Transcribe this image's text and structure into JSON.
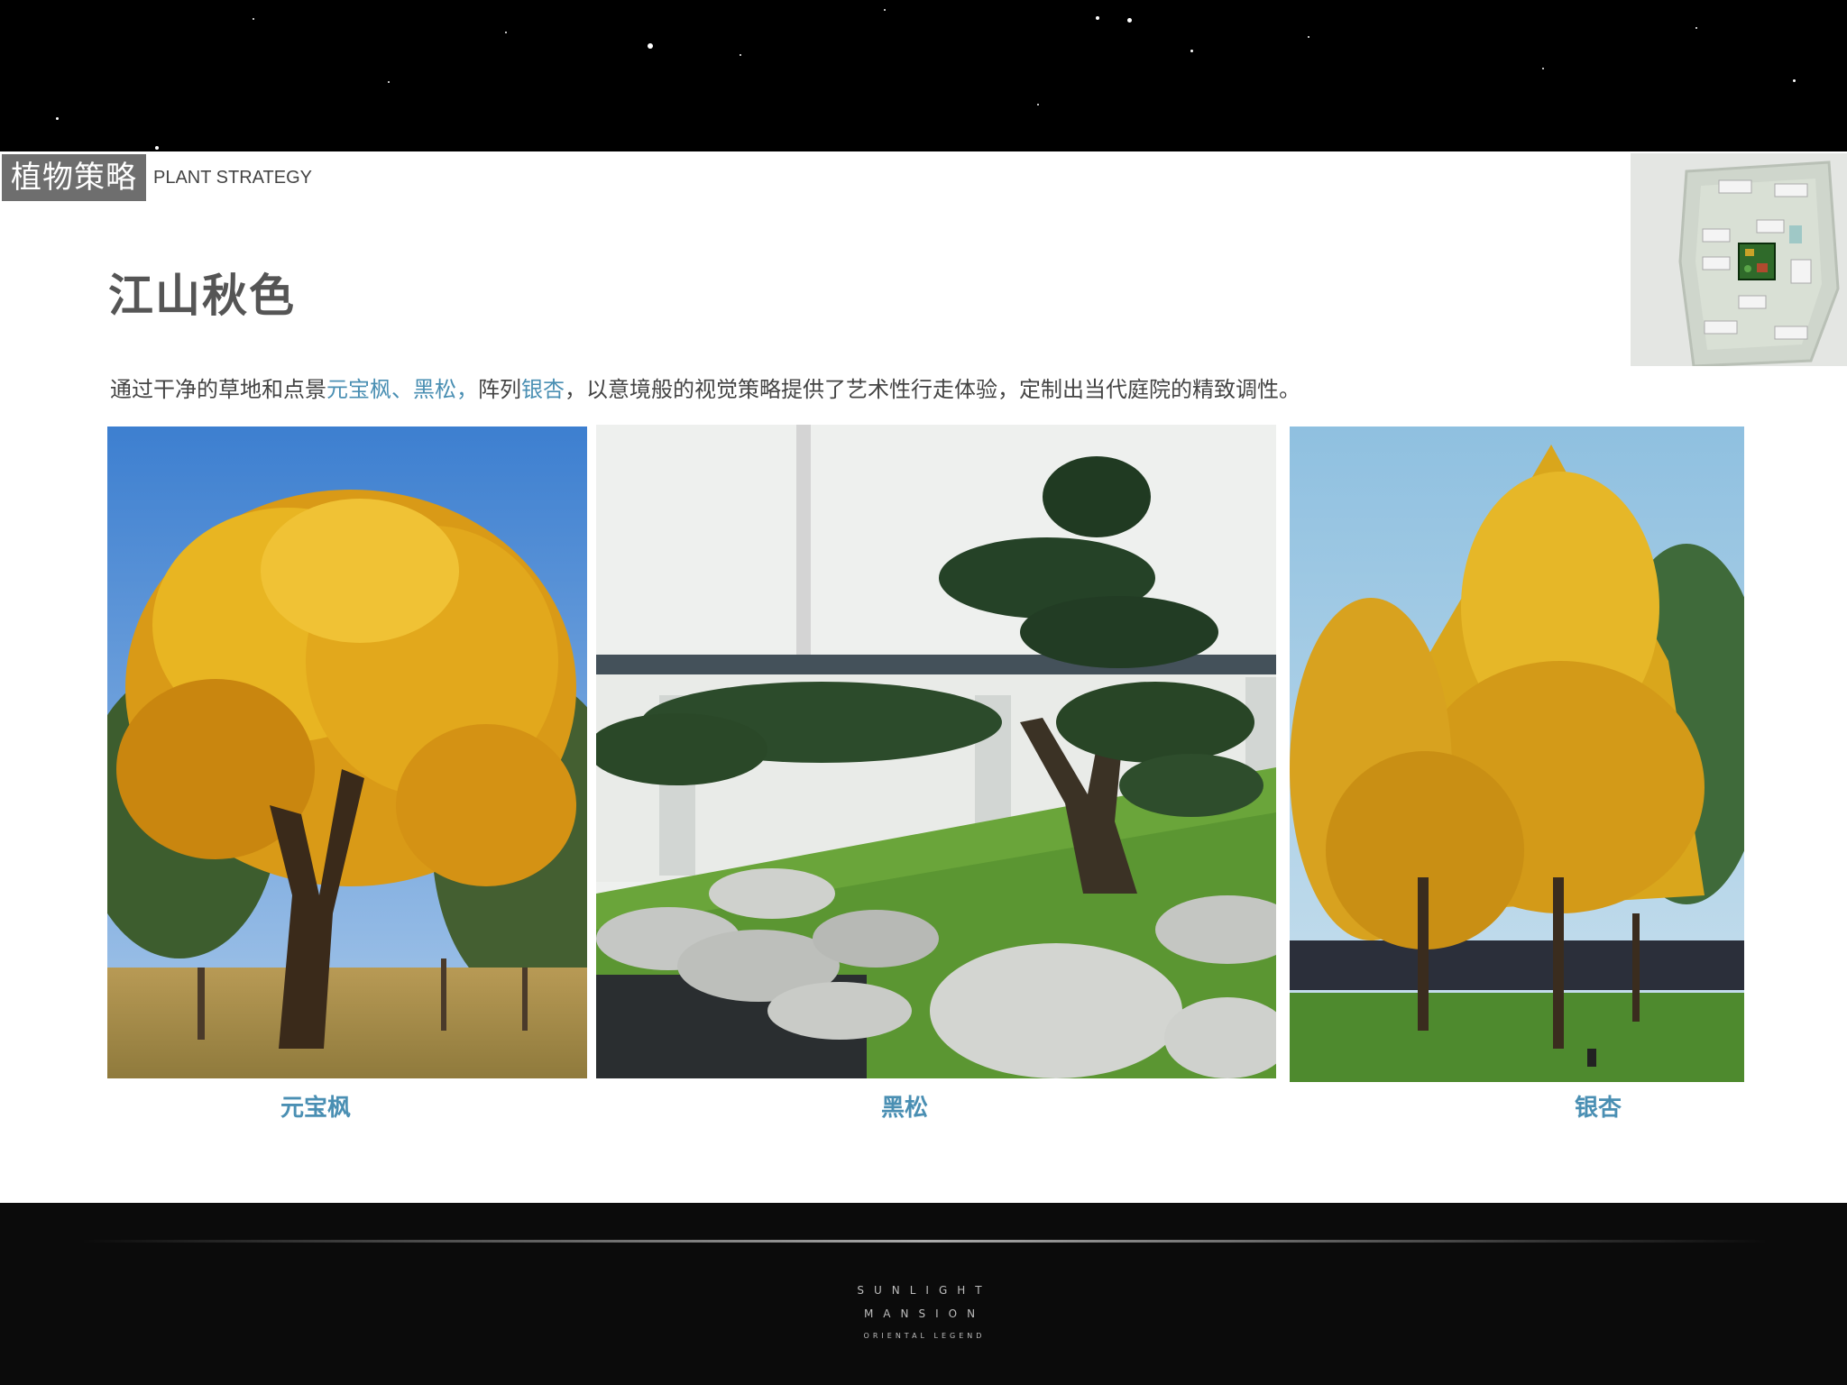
{
  "header": {
    "section_cn": "植物策略",
    "section_en": "PLANT STRATEGY"
  },
  "title": "江山秋色",
  "description": {
    "part1": "通过干净的草地和点景",
    "hl1": "元宝枫、黑松，",
    "part2": "阵列",
    "hl2": "银杏",
    "part3": "，以意境般的视觉策略提供了艺术性行走体验，定制出当代庭院的精致调性。"
  },
  "photos": [
    {
      "caption": "元宝枫",
      "icon": "maple-tree-photo"
    },
    {
      "caption": "黑松",
      "icon": "black-pine-photo"
    },
    {
      "caption": "银杏",
      "icon": "ginkgo-tree-photo"
    }
  ],
  "footer": {
    "line1": "SUNLIGHT",
    "line2": "MANSION",
    "line3": "ORIENTAL LEGEND"
  },
  "colors": {
    "highlight": "#4a8fb3",
    "tag_bg": "#6e6e6e",
    "title": "#555555"
  }
}
